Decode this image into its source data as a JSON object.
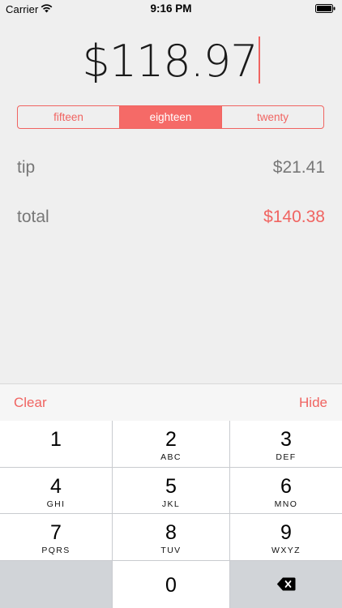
{
  "status_bar": {
    "carrier": "Carrier",
    "time": "9:16 PM",
    "icons": [
      "wifi-icon",
      "battery-icon"
    ]
  },
  "bill": {
    "amount": "$118.97"
  },
  "tip_selector": {
    "options": [
      "fifteen",
      "eighteen",
      "twenty"
    ],
    "selected": "eighteen"
  },
  "summary": {
    "tip_label": "tip",
    "tip_value": "$21.41",
    "total_label": "total",
    "total_value": "$140.38"
  },
  "keyboard_toolbar": {
    "clear_label": "Clear",
    "hide_label": "Hide"
  },
  "keypad": {
    "keys": [
      {
        "digit": "1",
        "letters": ""
      },
      {
        "digit": "2",
        "letters": "ABC"
      },
      {
        "digit": "3",
        "letters": "DEF"
      },
      {
        "digit": "4",
        "letters": "GHI"
      },
      {
        "digit": "5",
        "letters": "JKL"
      },
      {
        "digit": "6",
        "letters": "MNO"
      },
      {
        "digit": "7",
        "letters": "PQRS"
      },
      {
        "digit": "8",
        "letters": "TUV"
      },
      {
        "digit": "9",
        "letters": "WXYZ"
      },
      {
        "digit": "0",
        "letters": ""
      }
    ],
    "backspace_icon": "backspace-icon"
  },
  "colors": {
    "accent": "#f06461",
    "background": "#efefef",
    "muted_text": "#777777"
  }
}
